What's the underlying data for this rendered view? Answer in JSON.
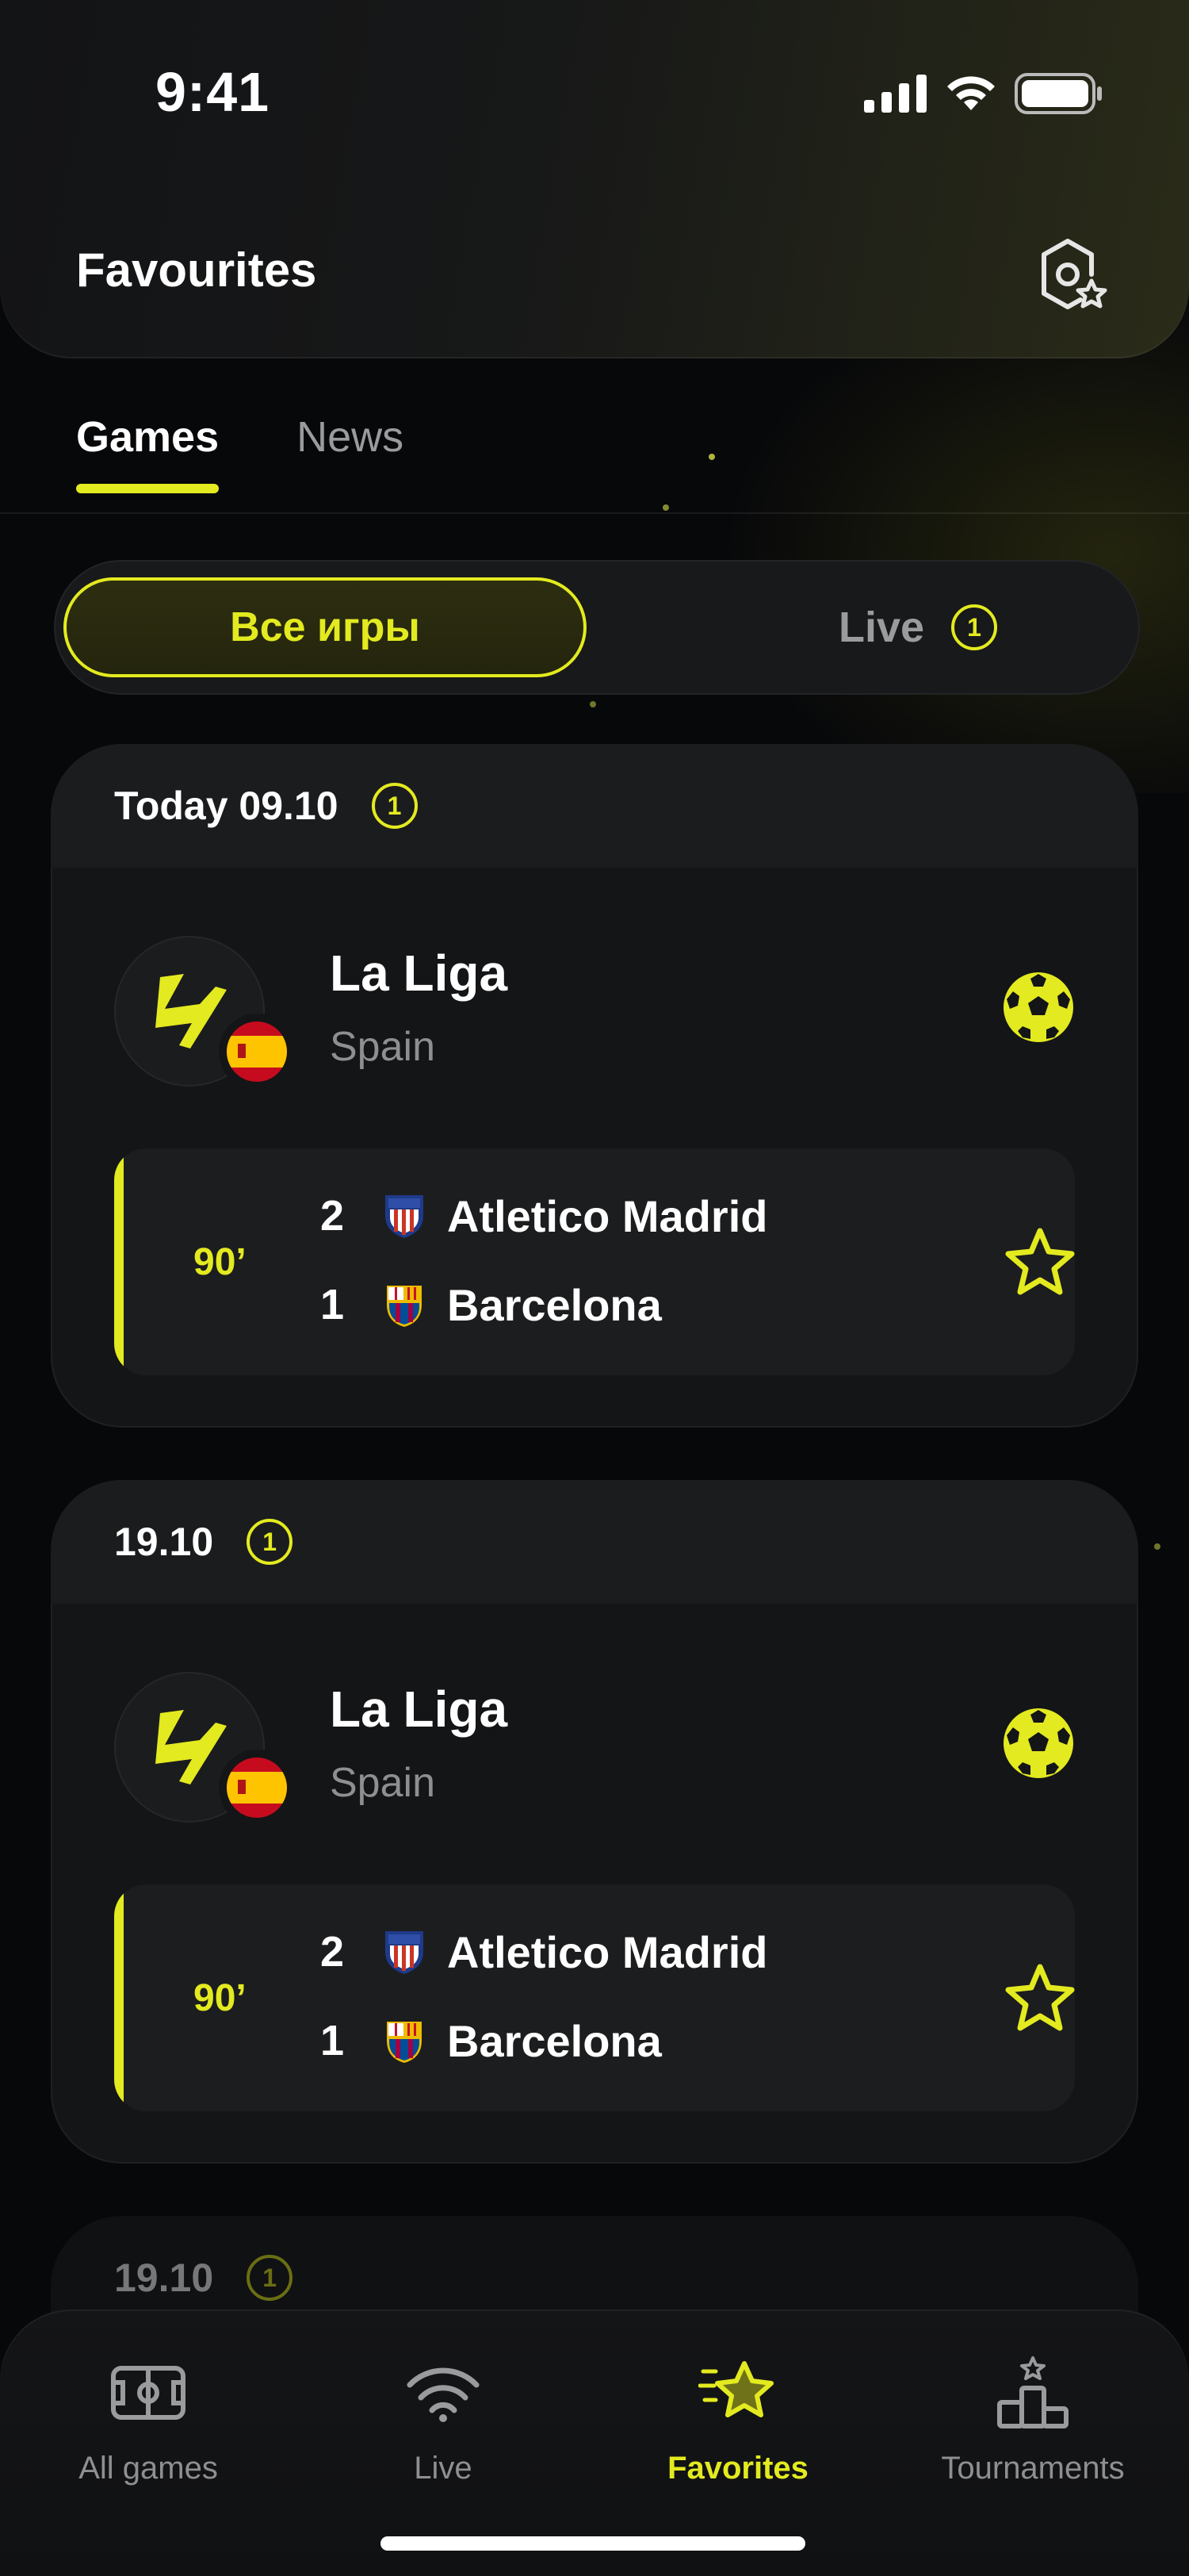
{
  "status_bar": {
    "time": "9:41"
  },
  "header": {
    "title": "Favourites",
    "settings_icon": "settings-star-icon"
  },
  "tabs": [
    {
      "label": "Games",
      "active": true
    },
    {
      "label": "News",
      "active": false
    }
  ],
  "segment": {
    "all_label": "Все игры",
    "live_label": "Live",
    "live_count": "1"
  },
  "cards": [
    {
      "date": "Today 09.10",
      "count": "1",
      "league": {
        "name": "La Liga",
        "country": "Spain"
      },
      "match": {
        "minute": "90’",
        "home": {
          "score": "2",
          "name": "Atletico Madrid"
        },
        "away": {
          "score": "1",
          "name": "Barcelona"
        }
      }
    },
    {
      "date": "19.10",
      "count": "1",
      "league": {
        "name": "La Liga",
        "country": "Spain"
      },
      "match": {
        "minute": "90’",
        "home": {
          "score": "2",
          "name": "Atletico Madrid"
        },
        "away": {
          "score": "1",
          "name": "Barcelona"
        }
      }
    },
    {
      "date": "19.10",
      "count": "1"
    }
  ],
  "bottom_nav": [
    {
      "label": "All games",
      "icon": "field-icon",
      "active": false
    },
    {
      "label": "Live",
      "icon": "signal-icon",
      "active": false
    },
    {
      "label": "Favorites",
      "icon": "star-icon",
      "active": true
    },
    {
      "label": "Tournaments",
      "icon": "podium-icon",
      "active": false
    }
  ],
  "colors": {
    "accent": "#e3ea1f",
    "background": "#07080a",
    "card": "#141517"
  }
}
